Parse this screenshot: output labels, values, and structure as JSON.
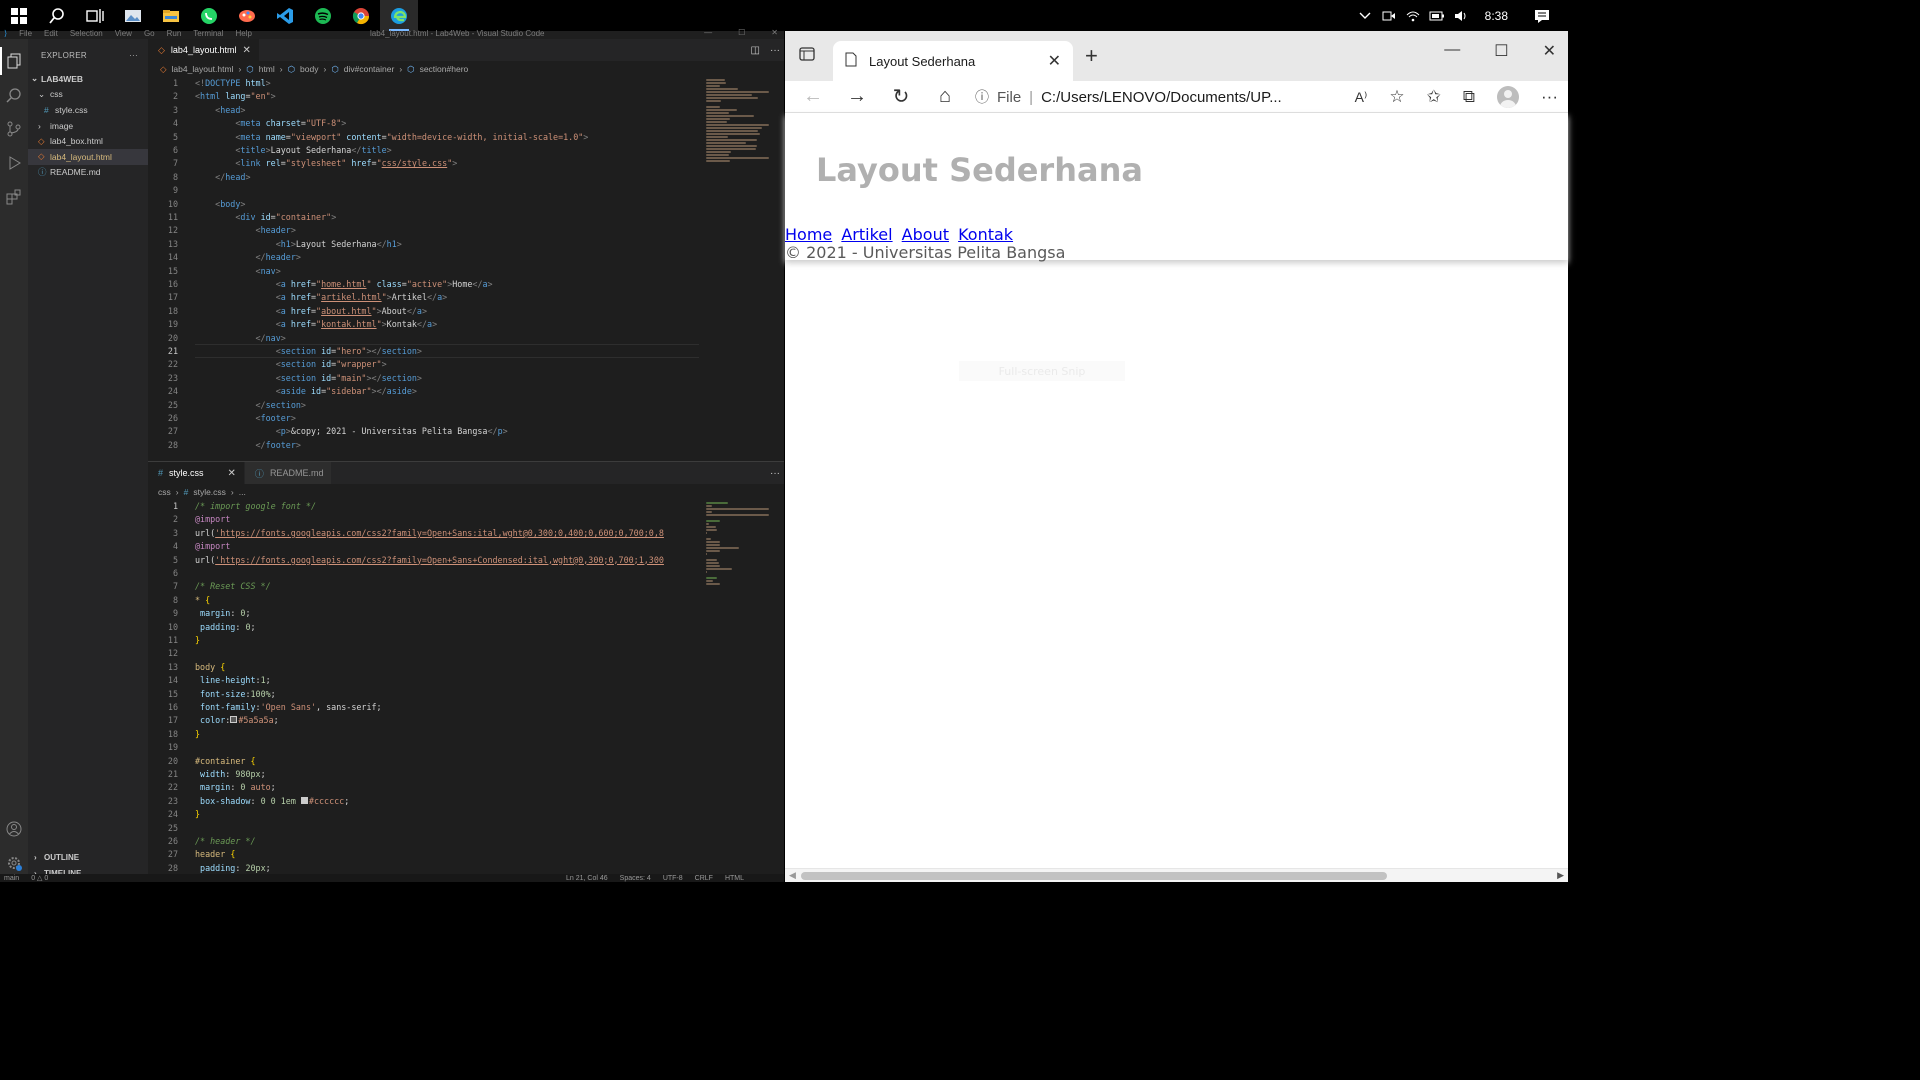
{
  "taskbar": {
    "apps": [
      "windows-icon",
      "search-icon",
      "task-view-icon",
      "photos-icon",
      "file-explorer-icon",
      "whatsapp-icon",
      "paint-icon",
      "vscode-icon",
      "spotify-icon",
      "chrome-icon",
      "edge-icon"
    ],
    "time": "8:38"
  },
  "vscode": {
    "menu": [
      "File",
      "Edit",
      "Selection",
      "View",
      "Go",
      "Run",
      "Terminal",
      "Help"
    ],
    "window_title": "lab4_layout.html - Lab4Web - Visual Studio Code",
    "explorer": {
      "header": "EXPLORER",
      "root": "LAB4WEB",
      "items": [
        {
          "label": "css",
          "kind": "folder-open",
          "indent": 1
        },
        {
          "label": "style.css",
          "kind": "css",
          "indent": 2
        },
        {
          "label": "image",
          "kind": "folder",
          "indent": 1
        },
        {
          "label": "lab4_box.html",
          "kind": "html",
          "indent": 1
        },
        {
          "label": "lab4_layout.html",
          "kind": "html",
          "indent": 1
        },
        {
          "label": "README.md",
          "kind": "md",
          "indent": 1
        }
      ],
      "outline": "OUTLINE",
      "timeline": "TIMELINE"
    },
    "editor1": {
      "tab": "lab4_layout.html",
      "breadcrumb": [
        "lab4_layout.html",
        "html",
        "body",
        "div#container",
        "section#hero"
      ],
      "current_line": 21
    },
    "editor2": {
      "tabs": [
        "style.css",
        "README.md"
      ],
      "breadcrumb": [
        "css",
        "style.css",
        "..."
      ]
    },
    "status": [
      "main",
      "0 △ 0",
      "Ln 21, Col 46",
      "Spaces: 4",
      "UTF-8",
      "CRLF",
      "HTML"
    ]
  },
  "browser": {
    "tab_title": "Layout Sederhana",
    "address_prefix": "File",
    "address": "C:/Users/LENOVO/Documents/UP...",
    "page": {
      "heading": "Layout Sederhana",
      "nav": [
        "Home",
        "Artikel",
        "About",
        "Kontak"
      ],
      "footer": "© 2021 - Universitas Pelita Bangsa",
      "fullscreen_hint": "Full-screen Snip"
    }
  }
}
